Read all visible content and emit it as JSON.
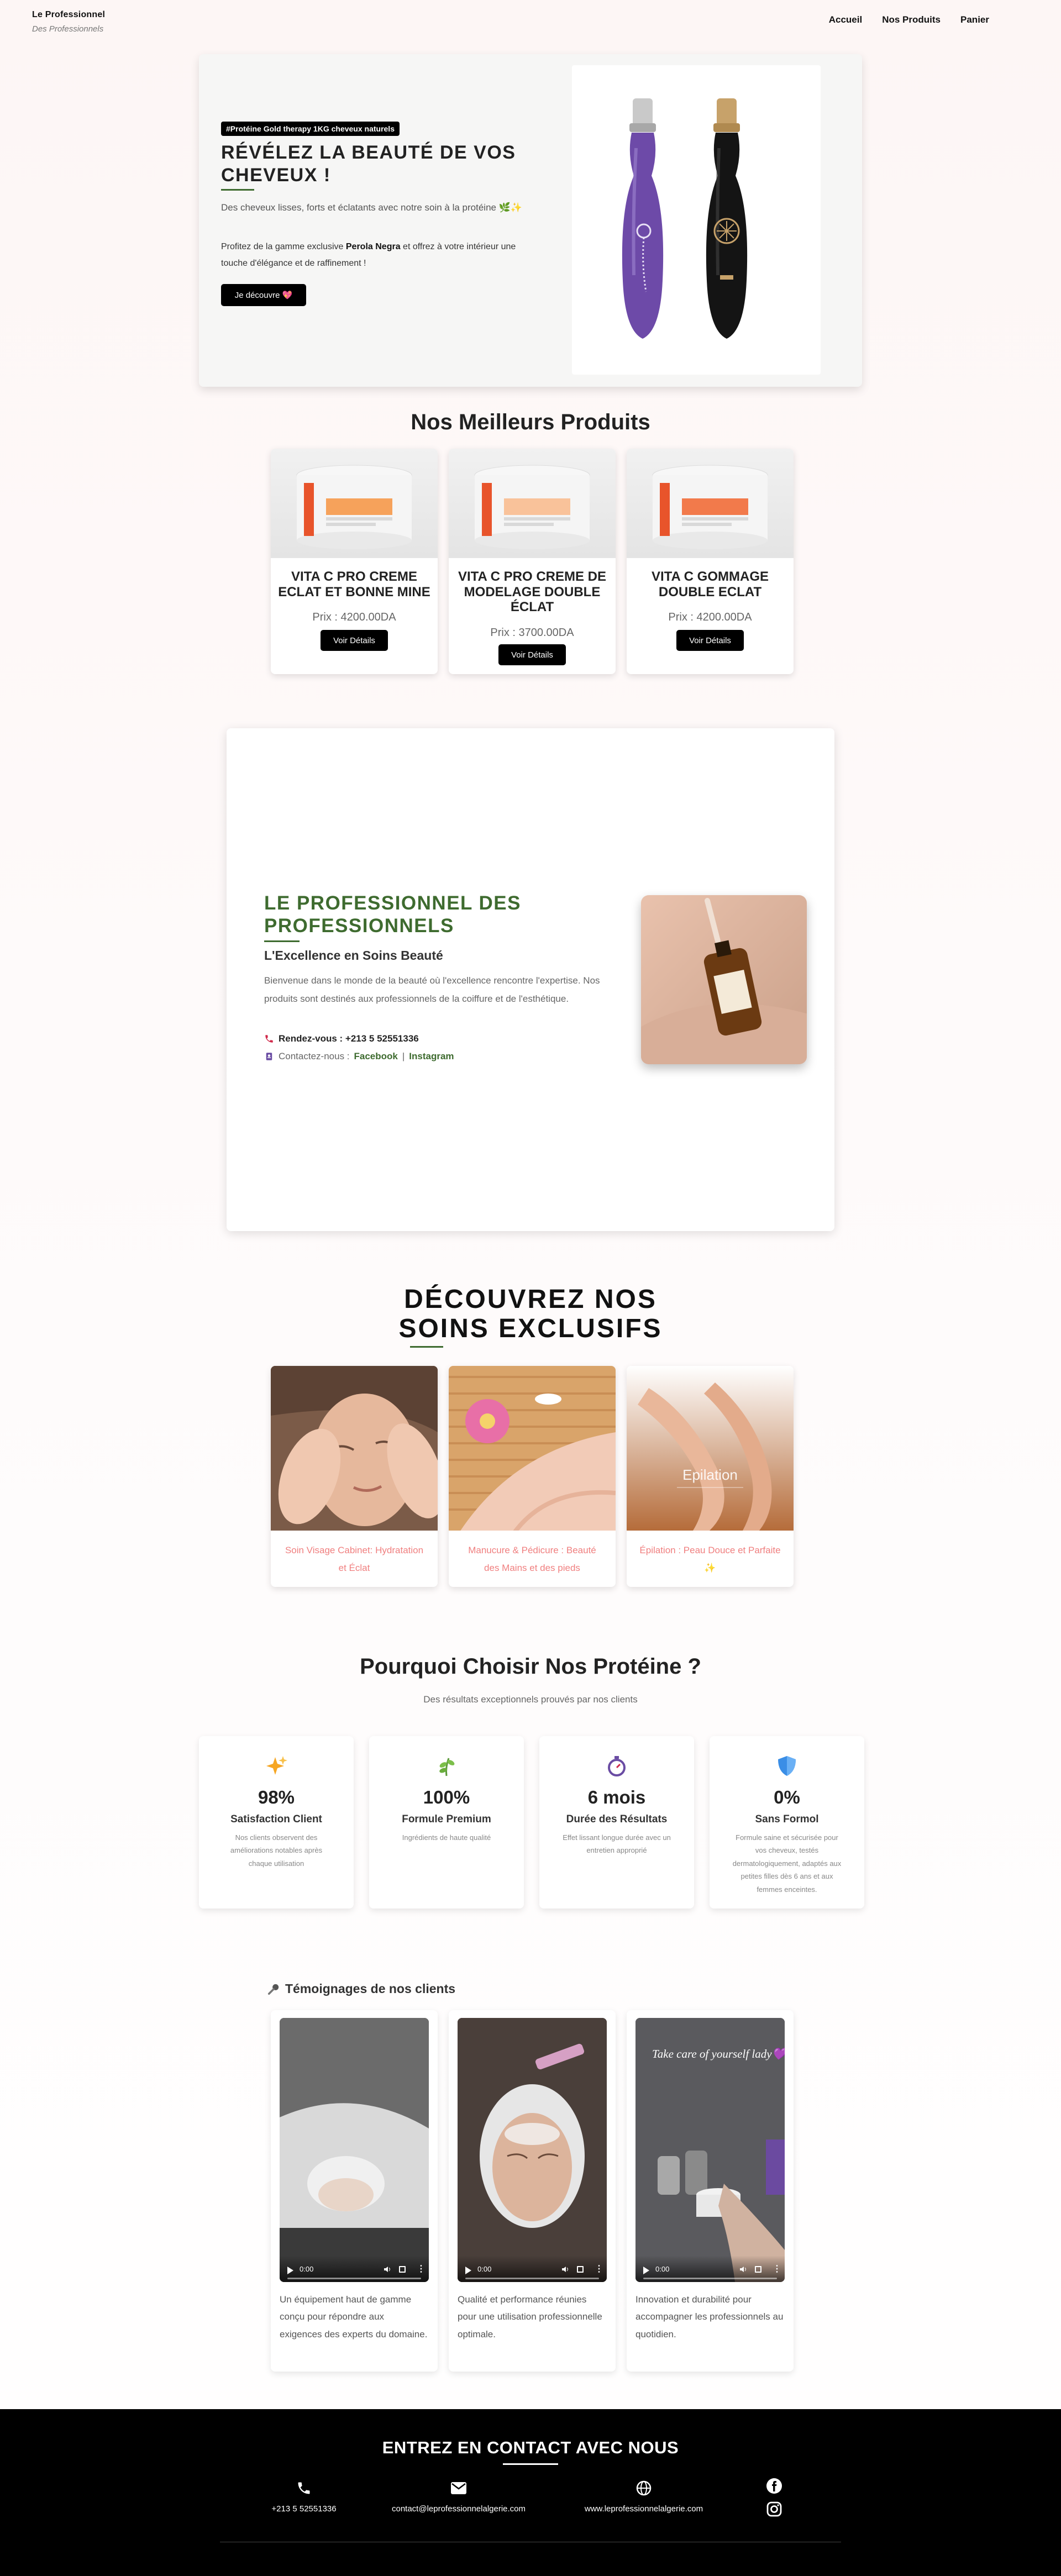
{
  "header": {
    "brand_name": "Le Professionnel",
    "brand_tagline": "Des Professionnels",
    "nav": [
      "Accueil",
      "Nos Produits",
      "Panier"
    ]
  },
  "hero": {
    "badge": "#Protéine Gold therapy 1KG cheveux naturels",
    "title": "RÉVÉLEZ LA BEAUTÉ DE VOS CHEVEUX !",
    "text1": "Des cheveux lisses, forts et éclatants avec notre soin à la protéine 🌿✨",
    "text2_before": "Profitez de la gamme exclusive ",
    "text2_bold": "Perola Negra",
    "text2_after": " et offrez à votre intérieur une touche d'élégance et de raffinement !",
    "button": "Je découvre 💖"
  },
  "products": {
    "title": "Nos Meilleurs Produits",
    "button_label": "Voir Détails",
    "items": [
      {
        "name": "VITA C PRO CREME ECLAT ET BONNE MINE",
        "price": "Prix : 4200.00DA"
      },
      {
        "name": "VITA C PRO CREME DE MODELAGE DOUBLE ÉCLAT",
        "price": "Prix : 3700.00DA"
      },
      {
        "name": "VITA C GOMMAGE DOUBLE ECLAT",
        "price": "Prix : 4200.00DA"
      }
    ]
  },
  "about": {
    "title": "LE PROFESSIONNEL DES PROFESSIONNELS",
    "subtitle": "L'Excellence en Soins Beauté",
    "text": "Bienvenue dans le monde de la beauté où l'excellence rencontre l'expertise. Nos produits sont destinés aux professionnels de la coiffure et de l'esthétique.",
    "phone": "Rendez-vous : +213 5 52551336",
    "contact_label": "Contactez-nous :",
    "facebook": "Facebook",
    "separator": "|",
    "instagram": "Instagram"
  },
  "services": {
    "title_line1": "DÉCOUVREZ NOS",
    "title_line2": "SOINS EXCLUSIFS",
    "items": [
      {
        "label": "Soin Visage Cabinet: Hydratation et Éclat"
      },
      {
        "label": "Manucure & Pédicure : Beauté des Mains et des pieds"
      },
      {
        "label": "Épilation : Peau Douce et Parfaite ✨",
        "image_text": "Epilation"
      }
    ]
  },
  "why": {
    "title": "Pourquoi Choisir Nos Protéine ?",
    "subtitle": "Des résultats exceptionnels prouvés par nos clients",
    "stats": [
      {
        "icon": "sparkles-icon",
        "value": "98%",
        "label": "Satisfaction Client",
        "desc": "Nos clients observent des améliorations notables après chaque utilisation"
      },
      {
        "icon": "herb-icon",
        "value": "100%",
        "label": "Formule Premium",
        "desc": "Ingrédients de haute qualité"
      },
      {
        "icon": "stopwatch-icon",
        "value": "6 mois",
        "label": "Durée des Résultats",
        "desc": "Effet lissant longue durée avec un entretien approprié"
      },
      {
        "icon": "shield-icon",
        "value": "0%",
        "label": "Sans Formol",
        "desc": "Formule saine et sécurisée pour vos cheveux, testés dermatologiquement, adaptés aux petites filles dès 6 ans et aux femmes enceintes."
      }
    ]
  },
  "testimonials": {
    "title": "Témoignages de nos clients",
    "items": [
      {
        "time": "0:00",
        "text": "Un équipement haut de gamme conçu pour répondre aux exigences des experts du domaine."
      },
      {
        "time": "0:00",
        "text": "Qualité et performance réunies pour une utilisation professionnelle optimale."
      },
      {
        "time": "0:00",
        "overlay": "Take care of yourself lady💜",
        "text": "Innovation et durabilité pour accompagner les professionnels au quotidien."
      }
    ]
  },
  "footer": {
    "title": "ENTREZ EN CONTACT AVEC NOUS",
    "phone": "+213 5 52551336",
    "email": "contact@leprofessionnelalgerie.com",
    "website": "www.leprofessionnelalgerie.com"
  },
  "colors": {
    "accent_green": "#3e6b2f",
    "service_pink": "#f07f7f",
    "button_black": "#000000"
  }
}
